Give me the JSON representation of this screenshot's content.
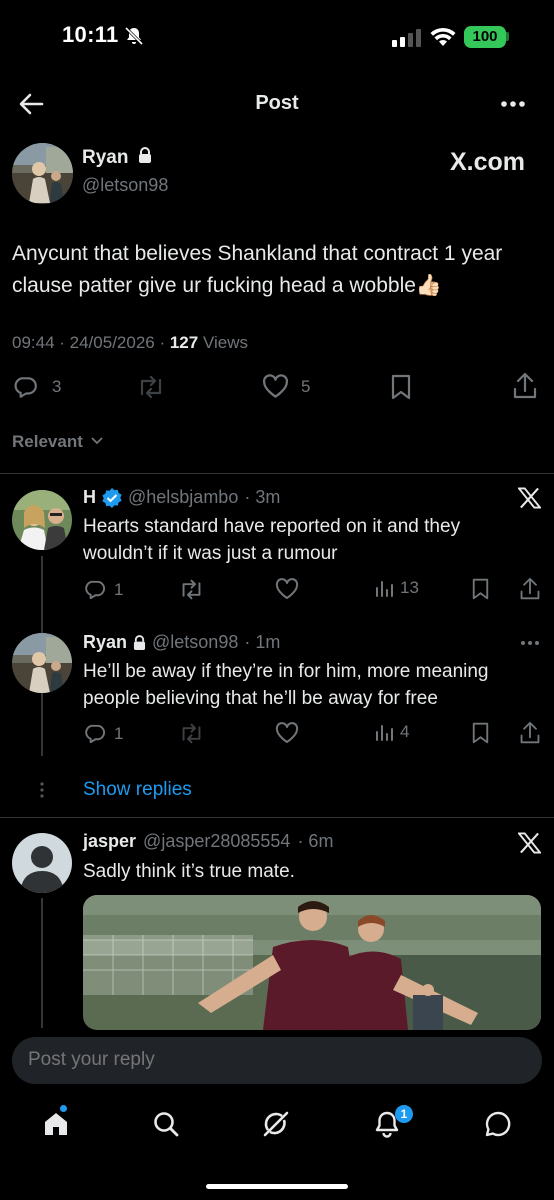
{
  "status_bar": {
    "time": "10:11",
    "battery": "100"
  },
  "header": {
    "title": "Post"
  },
  "main_post": {
    "name": "Ryan",
    "handle": "@letson98",
    "source_badge": "X.com",
    "text": "Anycunt that believes Shankland that contract 1 year clause patter give ur fucking head a wobble👍🏻",
    "timestamp": "09:44 · 24/05/2026 · ",
    "views_count": "127",
    "views_label": " Views",
    "replies": "3",
    "likes": "5"
  },
  "filter": {
    "label": "Relevant"
  },
  "replies": [
    {
      "name": "H",
      "handle": "@helsbjambo",
      "time": "· 3m",
      "text": "Hearts standard have reported on it and they wouldn’t if it was just a rumour",
      "replies": "1",
      "views": "13"
    },
    {
      "name": "Ryan",
      "handle": "@letson98",
      "time": "· 1m",
      "text": "He’ll be away if they’re in for him, more meaning people believing that he’ll be away for free",
      "replies": "1",
      "views": "4"
    },
    {
      "name": "jasper",
      "handle": "@jasper28085554",
      "time": "· 6m",
      "text": "Sadly think it’s true mate."
    }
  ],
  "show_replies": "Show replies",
  "reply_box": {
    "placeholder": "Post your reply"
  },
  "nav": {
    "notification_count": "1"
  },
  "colors": {
    "accent": "#1d9bf0",
    "background": "#000000",
    "muted": "#71767b",
    "battery": "#34c759"
  }
}
